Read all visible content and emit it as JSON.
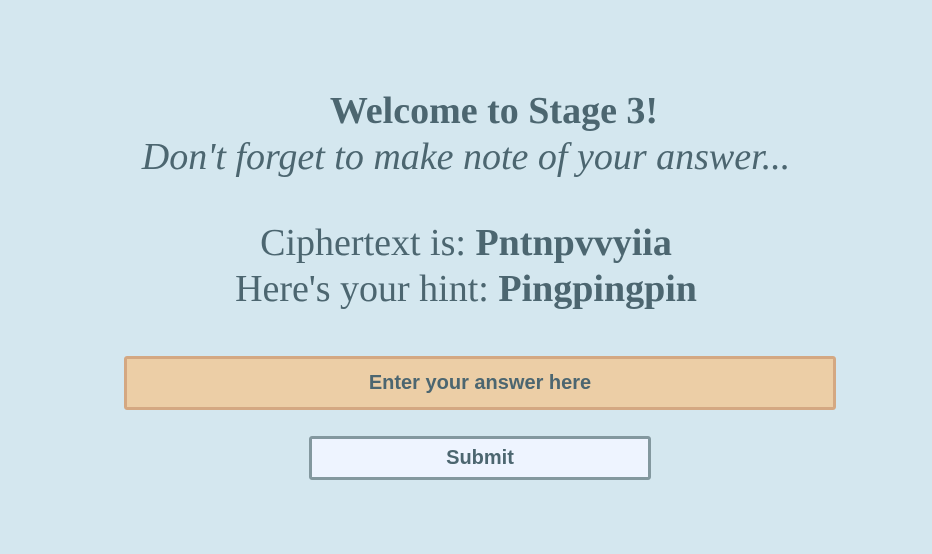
{
  "header": {
    "title": "Welcome to Stage 3!",
    "subtitle": "Don't forget to make note of your answer..."
  },
  "puzzle": {
    "ciphertext_label": "Ciphertext is: ",
    "ciphertext_value": "Pntnpvvyiia",
    "hint_label": "Here's your hint: ",
    "hint_value": "Pingpingpin"
  },
  "form": {
    "answer_value": "",
    "answer_placeholder": "Enter your answer here",
    "submit_label": "Submit"
  },
  "colors": {
    "background": "#d4e7ef",
    "text": "#4c6670",
    "input_background": "#eccea6",
    "input_border": "#d4a882",
    "button_background": "#eef4ff",
    "button_border": "#83989f"
  }
}
